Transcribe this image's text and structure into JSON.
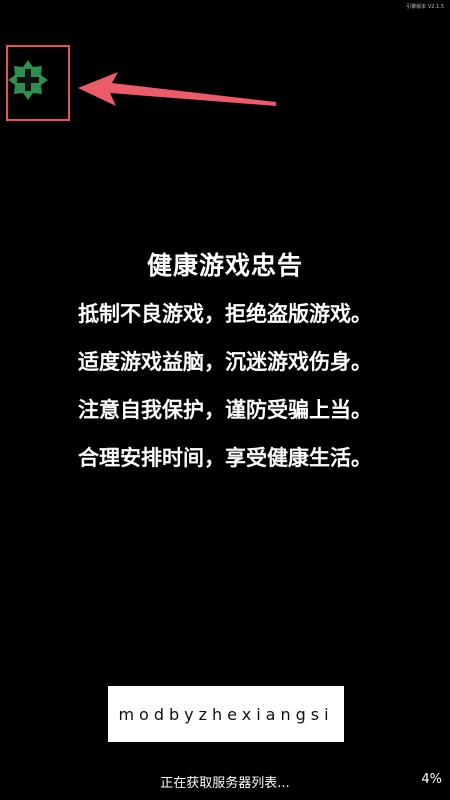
{
  "version_label": "引擎版本 V2.1.5",
  "notice": {
    "title": "健康游戏忠告",
    "lines": [
      "抵制不良游戏，拒绝盗版游戏。",
      "适度游戏益脑，沉迷游戏伤身。",
      "注意自我保护，谨防受骗上当。",
      "合理安排时间，享受健康生活。"
    ]
  },
  "mod_credit": "modbyzhexiangsi",
  "status": {
    "text": "正在获取服务器列表...",
    "progress": "4%"
  },
  "icons": {
    "plus_badge": "plus-badge-icon",
    "arrow": "arrow-left-icon"
  },
  "colors": {
    "background": "#000000",
    "highlight": "#e8505b",
    "badge_green": "#2f8f4e",
    "badge_plus": "#111111"
  }
}
